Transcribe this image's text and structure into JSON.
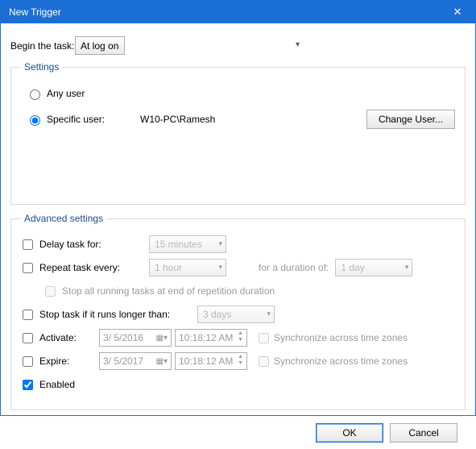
{
  "window": {
    "title": "New Trigger"
  },
  "begin": {
    "label": "Begin the task:",
    "value": "At log on"
  },
  "settings": {
    "legend": "Settings",
    "any_user": "Any user",
    "specific_user": "Specific user:",
    "username": "W10-PC\\Ramesh",
    "change_user": "Change User..."
  },
  "advanced": {
    "legend": "Advanced settings",
    "delay": {
      "label": "Delay task for:",
      "value": "15 minutes"
    },
    "repeat": {
      "label": "Repeat task every:",
      "value": "1 hour",
      "duration_label": "for a duration of:",
      "duration_value": "1 day"
    },
    "stop_all": "Stop all running tasks at end of repetition duration",
    "stop_if": {
      "label": "Stop task if it runs longer than:",
      "value": "3 days"
    },
    "activate": {
      "label": "Activate:",
      "date": "3/  5/2016",
      "time": "10:18:12 AM",
      "sync": "Synchronize across time zones"
    },
    "expire": {
      "label": "Expire:",
      "date": "3/  5/2017",
      "time": "10:18:12 AM",
      "sync": "Synchronize across time zones"
    },
    "enabled": "Enabled"
  },
  "buttons": {
    "ok": "OK",
    "cancel": "Cancel"
  }
}
